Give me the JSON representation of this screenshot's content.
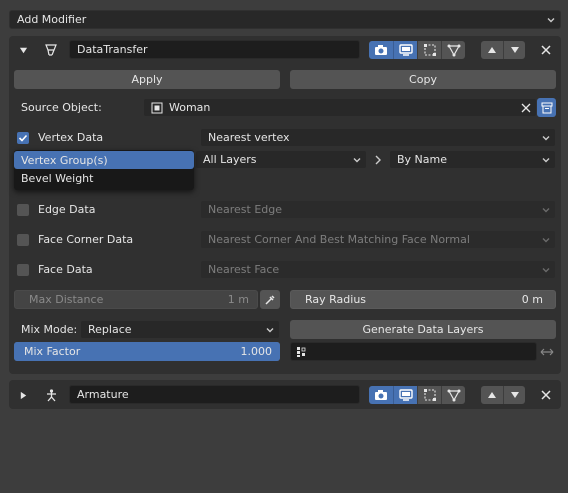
{
  "add_modifier": {
    "label": "Add Modifier"
  },
  "modifier1": {
    "name": "DataTransfer",
    "apply_label": "Apply",
    "copy_label": "Copy",
    "source_object_label": "Source Object:",
    "source_object_value": "Woman",
    "vertex_data": {
      "label": "Vertex Data",
      "checked": true,
      "mode": "Nearest vertex"
    },
    "vertex_types_menu": [
      {
        "label": "Vertex Group(s)",
        "selected": true
      },
      {
        "label": "Bevel Weight",
        "selected": false
      }
    ],
    "layers_select": "All Layers",
    "mapping_select": "By Name",
    "edge_data": {
      "label": "Edge Data",
      "checked": false,
      "mode": "Nearest Edge"
    },
    "face_corner_data": {
      "label": "Face Corner Data",
      "checked": false,
      "mode": "Nearest Corner And Best Matching Face Normal"
    },
    "face_data": {
      "label": "Face Data",
      "checked": false,
      "mode": "Nearest Face"
    },
    "max_distance": {
      "label": "Max Distance",
      "value": "1 m"
    },
    "ray_radius": {
      "label": "Ray Radius",
      "value": "0 m"
    },
    "mix_mode_label": "Mix Mode:",
    "mix_mode_value": "Replace",
    "generate_label": "Generate Data Layers",
    "mix_factor": {
      "label": "Mix Factor",
      "value": "1.000",
      "fraction": 1.0
    }
  },
  "modifier2": {
    "name": "Armature"
  },
  "colors": {
    "accent": "#4772b3",
    "panel": "#303030",
    "background": "#3d3d3d",
    "field": "#545454",
    "dark_field": "#1d1d1d"
  }
}
